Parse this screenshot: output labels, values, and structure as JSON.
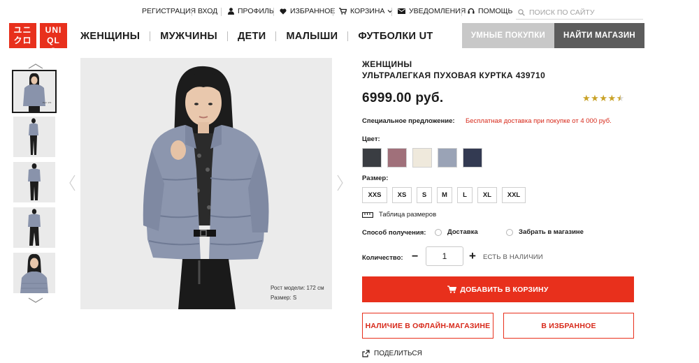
{
  "utility_nav": {
    "register": "РЕГИСТРАЦИЯ",
    "login": "ВХОД",
    "profile": "ПРОФИЛЬ",
    "favorites": "ИЗБРАННОЕ",
    "cart": "КОРЗИНА",
    "notifications": "УВЕДОМЛЕНИЯ",
    "help": "ПОМОЩЬ",
    "search_placeholder": "ПОИСК ПО САЙТУ"
  },
  "logo": {
    "left": "ユニクロ",
    "right": "UNIQLO"
  },
  "main_nav": {
    "items": [
      "ЖЕНЩИНЫ",
      "МУЖЧИНЫ",
      "ДЕТИ",
      "МАЛЫШИ",
      "ФУТБОЛКИ UT"
    ],
    "smart_shopping": "УМНЫЕ ПОКУПКИ",
    "find_store": "НАЙТИ МАГАЗИН"
  },
  "gallery": {
    "thumbnail_count": 5,
    "active_index": 0,
    "caption_height": "Рост модели: 172 см",
    "caption_size": "Размер: S"
  },
  "product": {
    "category": "ЖЕНЩИНЫ",
    "name": "УЛЬТРАЛЕГКАЯ ПУХОВАЯ КУРТКА 439710",
    "price": "6999.00 руб.",
    "rating": 4.5,
    "offer_label": "Специальное предложение:",
    "offer_text": "Бесплатная доставка при покупке от 4 000 руб.",
    "color_label": "Цвет:",
    "colors": [
      "#3a3d42",
      "#a0707a",
      "#efe9dc",
      "#9aa3b6",
      "#333a52"
    ],
    "size_label": "Размер:",
    "sizes": [
      "XXS",
      "XS",
      "S",
      "M",
      "L",
      "XL",
      "XXL"
    ],
    "size_table": "Таблица размеров",
    "pickup_label": "Способ получения:",
    "pickup_options": [
      "Доставка",
      "Забрать в магазине"
    ],
    "quantity_label": "Количество:",
    "quantity": "1",
    "stock": "ЕСТЬ В НАЛИЧИИ",
    "add_to_cart": "ДОБАВИТЬ В КОРЗИНУ",
    "offline_availability": "НАЛИЧИЕ В ОФЛАЙН-МАГАЗИНЕ",
    "add_to_favorites": "В ИЗБРАННОЕ",
    "share": "ПОДЕЛИТЬСЯ"
  },
  "colors": {
    "brand_red": "#e8301c",
    "offer_red": "#d7291a",
    "grey_button": "#c8c8c8",
    "dark_button": "#5c5c5c"
  }
}
